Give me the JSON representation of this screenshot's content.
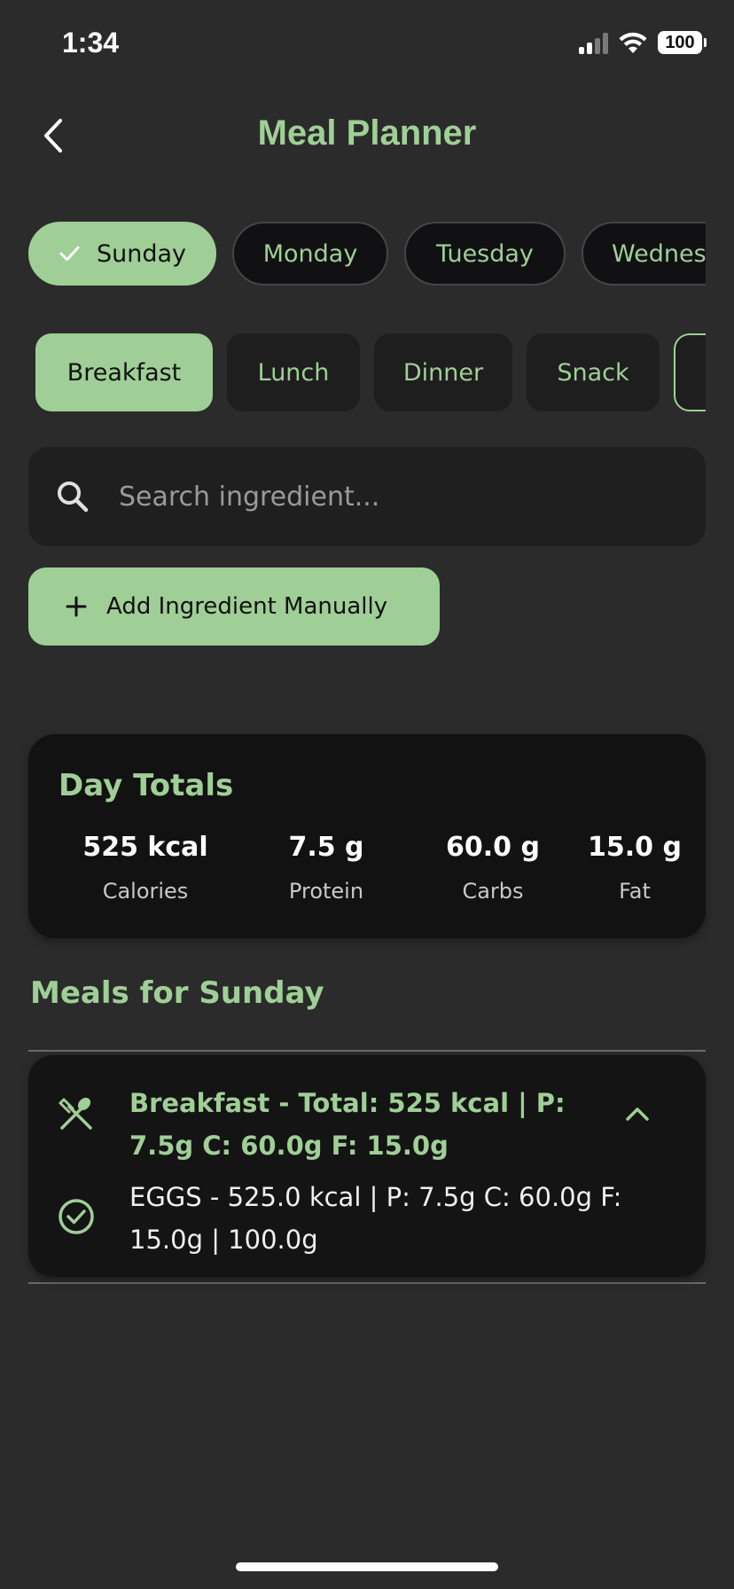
{
  "status_bar": {
    "time": "1:34",
    "battery": "100"
  },
  "header": {
    "title": "Meal Planner",
    "back_icon": "chevron-left-icon"
  },
  "days": {
    "items": [
      {
        "label": "Sunday",
        "selected": true
      },
      {
        "label": "Monday",
        "selected": false
      },
      {
        "label": "Tuesday",
        "selected": false
      },
      {
        "label": "Wednes",
        "selected": false
      }
    ]
  },
  "meal_types": {
    "items": [
      {
        "label": "Breakfast",
        "selected": true
      },
      {
        "label": "Lunch",
        "selected": false
      },
      {
        "label": "Dinner",
        "selected": false
      },
      {
        "label": "Snack",
        "selected": false
      }
    ]
  },
  "search": {
    "placeholder": "Search ingredient..."
  },
  "add_button": {
    "label": "Add Ingredient Manually"
  },
  "day_totals": {
    "title": "Day Totals",
    "items": [
      {
        "value": "525 kcal",
        "label": "Calories"
      },
      {
        "value": "7.5 g",
        "label": "Protein"
      },
      {
        "value": "60.0 g",
        "label": "Carbs"
      },
      {
        "value": "15.0 g",
        "label": "Fat"
      }
    ]
  },
  "meals_section": {
    "heading": "Meals for Sunday",
    "meals": [
      {
        "summary": "Breakfast - Total: 525 kcal | P: 7.5g C: 60.0g F: 15.0g",
        "ingredients": [
          {
            "text": "EGGS - 525.0 kcal | P: 7.5g C: 60.0g F: 15.0g | 100.0g"
          }
        ]
      }
    ]
  },
  "colors": {
    "accent": "#9fcf96",
    "background": "#2b2b2b",
    "card": "#121212"
  }
}
